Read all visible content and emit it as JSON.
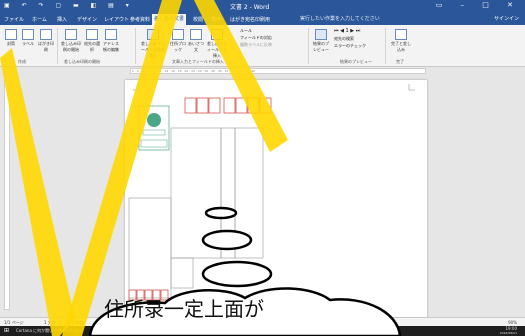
{
  "titlebar": {
    "title": "文書 2 - Word",
    "window_controls": [
      "▭",
      "–",
      "□",
      "✕"
    ]
  },
  "tabs": [
    "ファイル",
    "ホーム",
    "挿入",
    "デザイン",
    "レイアウト",
    "参考資料",
    "差し込み文書",
    "校閲",
    "表示",
    "はがき宛名印刷用"
  ],
  "active_tab_index": 6,
  "tellme": {
    "placeholder": "実行したい作業を入力してください"
  },
  "user": {
    "name": "サインイン",
    "share": "共有"
  },
  "ribbon": {
    "groups": [
      {
        "label": "作成",
        "buttons": [
          "封筒",
          "ラベル",
          "はがき印刷"
        ]
      },
      {
        "label": "差し込み印刷の開始",
        "buttons": [
          "差し込み印刷の開始",
          "宛先の選択",
          "アドレス帳の編集"
        ]
      },
      {
        "label": "文章入力とフィールドの挿入",
        "buttons": [
          "差し込みフィールドの強調表示",
          "住所ブロック",
          "あいさつ文",
          "差し込みフィールドの挿入"
        ]
      },
      {
        "label": "結果のプレビュー",
        "buttons": [
          "結果のプレビュー",
          "宛先の検索",
          "エラーのチェック"
        ]
      },
      {
        "label": "完了",
        "buttons": [
          "完了と差し込み"
        ]
      }
    ],
    "small_items": [
      "ルール",
      "フィールドの対応",
      "複数ラベルに反映"
    ],
    "record_nav": "1"
  },
  "statusbar": {
    "page": "1/1 ページ",
    "words": "1 文字",
    "language": "日本語",
    "zoom": "90%"
  },
  "taskbar": {
    "search": "Cortana に何か聞いてみてください",
    "time": "19:00",
    "date": "2016/08/01"
  },
  "annotation": {
    "thought_text": "住所录一定上面が"
  }
}
